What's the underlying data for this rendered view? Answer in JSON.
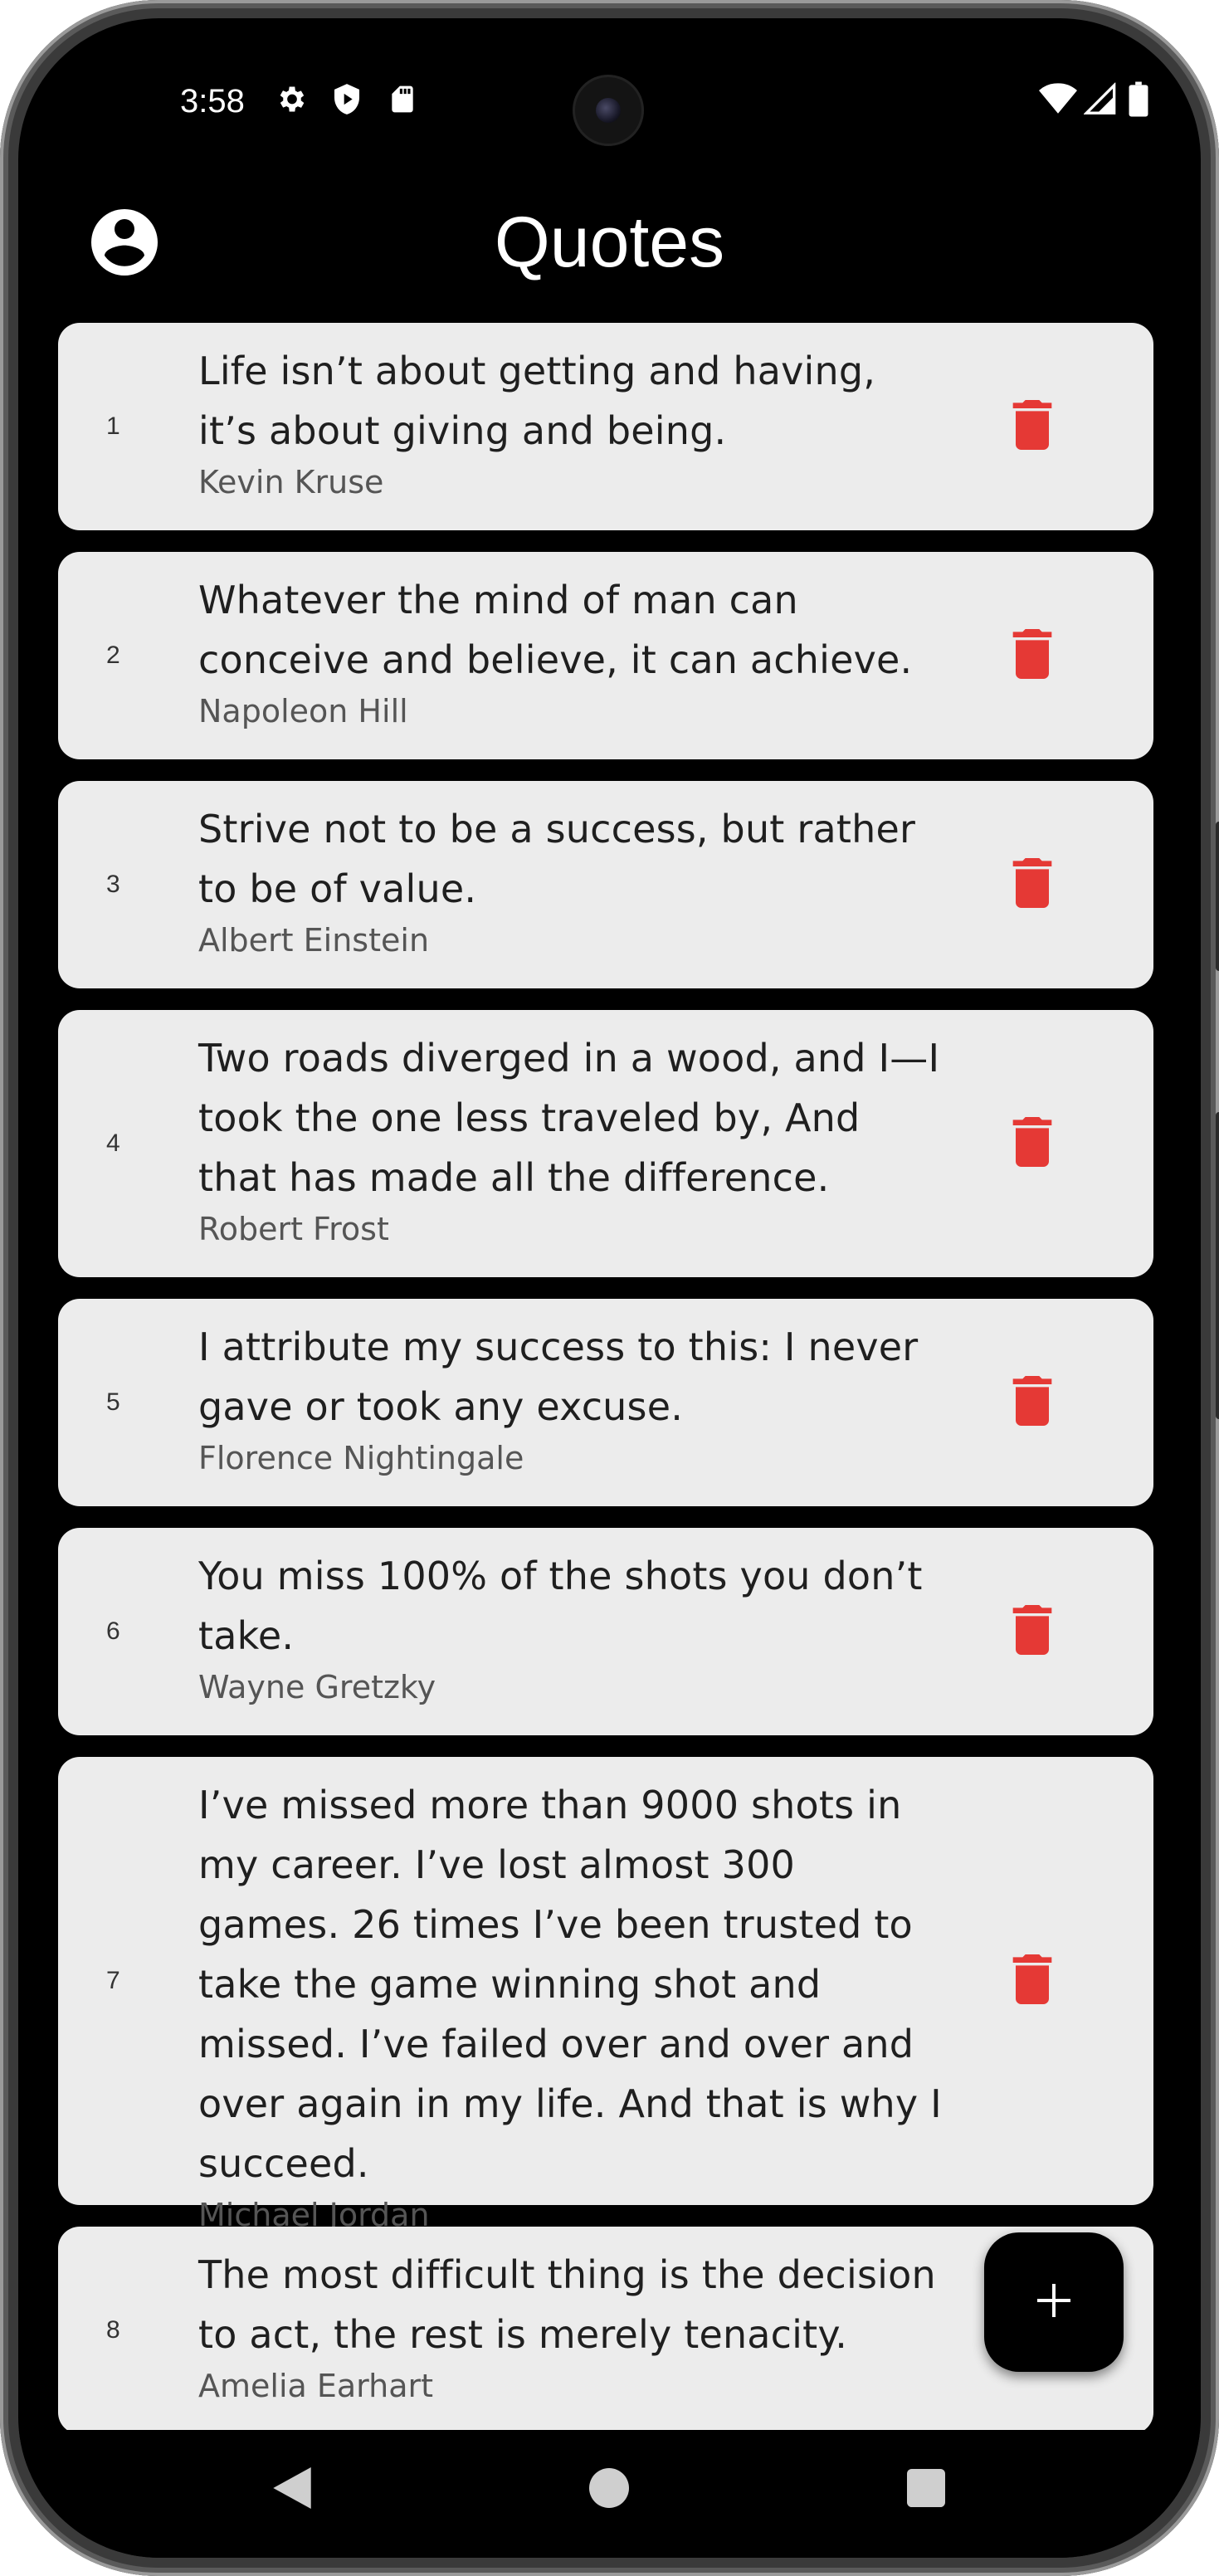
{
  "status_bar": {
    "time": "3:58"
  },
  "app_bar": {
    "title": "Quotes"
  },
  "colors": {
    "delete_icon": "#e53935",
    "card_background": "#ececec",
    "fab_background": "#000000",
    "screen_background": "#000000"
  },
  "quotes": [
    {
      "number": "1",
      "text": "Life isn’t about getting and having, it’s about giving and being.",
      "author": "Kevin Kruse"
    },
    {
      "number": "2",
      "text": "Whatever the mind of man can conceive and believe, it can achieve.",
      "author": "Napoleon Hill"
    },
    {
      "number": "3",
      "text": "Strive not to be a success, but rather to be of value.",
      "author": "Albert Einstein"
    },
    {
      "number": "4",
      "text": "Two roads diverged in a wood, and I—I took the one less traveled by, And that has made all the difference.",
      "author": "Robert Frost"
    },
    {
      "number": "5",
      "text": "I attribute my success to this: I never gave or took any excuse.",
      "author": "Florence Nightingale"
    },
    {
      "number": "6",
      "text": "You miss 100% of the shots you don’t take.",
      "author": "Wayne Gretzky"
    },
    {
      "number": "7",
      "text": "I’ve missed more than 9000 shots in my career. I’ve lost almost 300 games. 26 times I’ve been trusted to take the game winning shot and missed. I’ve failed over and over and over again in my life. And that is why I succeed.",
      "author": "Michael Jordan"
    },
    {
      "number": "8",
      "text": "The most difficult thing is the decision to act, the rest is merely tenacity.",
      "author": "Amelia Earhart"
    }
  ],
  "icons": {
    "account": "account-circle-icon",
    "delete": "trash-icon",
    "add": "plus-icon",
    "back": "back-triangle-icon",
    "home": "home-circle-icon",
    "recents": "recents-square-icon",
    "settings": "gear-icon",
    "shield": "shield-play-icon",
    "sd_card": "sd-card-icon",
    "wifi": "wifi-icon",
    "signal": "signal-icon",
    "battery": "battery-icon"
  }
}
